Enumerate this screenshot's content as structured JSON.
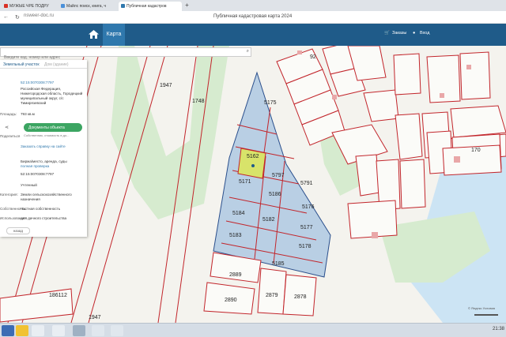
{
  "browser": {
    "tabs": [
      {
        "label": "МУЖЫЕ ЧРЕ ПОДРУ",
        "color": "#d93025"
      },
      {
        "label": "Майлс поиск, книга, ч",
        "color": "#4a90d9"
      },
      {
        "label": "Публичная кадастров",
        "color": "#2f78ad"
      }
    ],
    "new_tab": "+",
    "url": "nsweer-doc.ru",
    "page_title": "Публичная кадастровая карта 2024"
  },
  "header": {
    "map_label": "Карта",
    "orders_label": "Заказы",
    "login_label": "Вход"
  },
  "search": {
    "placeholder": "Введите кад. номер или адрес"
  },
  "panel": {
    "tab_active": "Земельный участок",
    "tab_inactive": "Дом (здание)",
    "cad_number": "52:15:0070308:7797",
    "address": "Российская Федерация, Нижегородская область, Городецкий муниципальный округ, с/с Тимирязевский",
    "area_label": "Площадь:",
    "area": "793 кв.м",
    "share_label": "Поделиться",
    "docs_button": "Документы объекта",
    "docs_sub": "Собственник, стоимость в до...",
    "order_link": "Заказать справку на сайте",
    "coords_text": "Биржа/место, аренда, суды",
    "price_link": "полная проверка",
    "code": "52:15:0070308:7797",
    "status": "Учтенный",
    "category_label": "Категория:",
    "category": "Земли сельскохозяйственного назначения",
    "ownership_label": "Собственность:",
    "ownership": "Частная собственность",
    "use_label": "Использование:",
    "use": "для дачного строительства",
    "back": "назад"
  },
  "map_labels": {
    "p1": "1947",
    "p2": "1748",
    "p3": "92",
    "p4": "170",
    "p5": "5175",
    "p6": "5162",
    "p7": "5797",
    "p8": "5171",
    "p9": "5186",
    "p10": "5184",
    "p11": "5182",
    "p12": "5176",
    "p13": "5177",
    "p14": "5178",
    "p15": "5183",
    "p16": "5185",
    "p17": "2889",
    "p18": "2890",
    "p19": "2879",
    "p20": "2878",
    "p21": "186112",
    "p22": "1947",
    "p23": "5791"
  },
  "map_copyright": "© Яндекс Условия",
  "taskbar": {
    "clock": "21:38"
  },
  "colors": {
    "header": "#1f5b89",
    "parcel_line": "#c2252b",
    "selected_fill": "#d8e36a",
    "block_fill": "#b9cfe4"
  }
}
